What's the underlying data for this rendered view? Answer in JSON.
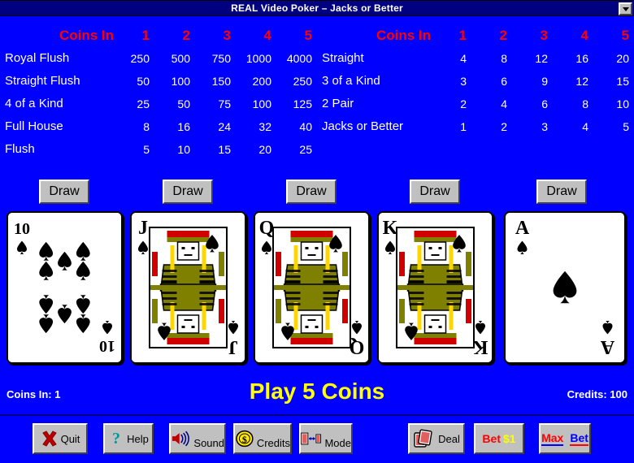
{
  "window": {
    "title": "REAL Video Poker – Jacks or Better",
    "combo_icon": "chevron-down-icon"
  },
  "colors": {
    "background": "#0000FF",
    "titlebar": "#000080",
    "paytable_header": "#FF0000",
    "paytable_value": "#FFFFFF",
    "message": "#FFFF00",
    "button_face": "#C0C0C0"
  },
  "paytable": {
    "header_label": "Coins In",
    "columns": [
      "1",
      "2",
      "3",
      "4",
      "5"
    ],
    "left_rows": [
      {
        "hand": "Royal Flush",
        "payouts": [
          "250",
          "500",
          "750",
          "1000",
          "4000"
        ]
      },
      {
        "hand": "Straight Flush",
        "payouts": [
          "50",
          "100",
          "150",
          "200",
          "250"
        ]
      },
      {
        "hand": "4 of a Kind",
        "payouts": [
          "25",
          "50",
          "75",
          "100",
          "125"
        ]
      },
      {
        "hand": "Full House",
        "payouts": [
          "8",
          "16",
          "24",
          "32",
          "40"
        ]
      },
      {
        "hand": "Flush",
        "payouts": [
          "5",
          "10",
          "15",
          "20",
          "25"
        ]
      }
    ],
    "right_rows": [
      {
        "hand": "Straight",
        "payouts": [
          "4",
          "8",
          "12",
          "16",
          "20"
        ]
      },
      {
        "hand": "3 of a Kind",
        "payouts": [
          "3",
          "6",
          "9",
          "12",
          "15"
        ]
      },
      {
        "hand": "2 Pair",
        "payouts": [
          "2",
          "4",
          "6",
          "8",
          "10"
        ]
      },
      {
        "hand": "Jacks or Better",
        "payouts": [
          "1",
          "2",
          "3",
          "4",
          "5"
        ]
      }
    ]
  },
  "draw_buttons": [
    {
      "label": "Draw"
    },
    {
      "label": "Draw"
    },
    {
      "label": "Draw"
    },
    {
      "label": "Draw"
    },
    {
      "label": "Draw"
    }
  ],
  "hand": [
    {
      "rank": "10",
      "suit": "spades",
      "suit_symbol": "♠",
      "color": "#000000",
      "type": "pip",
      "pips": 10
    },
    {
      "rank": "J",
      "suit": "spades",
      "suit_symbol": "♠",
      "color": "#000000",
      "type": "court"
    },
    {
      "rank": "Q",
      "suit": "spades",
      "suit_symbol": "♠",
      "color": "#000000",
      "type": "court"
    },
    {
      "rank": "K",
      "suit": "spades",
      "suit_symbol": "♠",
      "color": "#000000",
      "type": "court"
    },
    {
      "rank": "A",
      "suit": "spades",
      "suit_symbol": "♠",
      "color": "#000000",
      "type": "pip",
      "pips": 1
    }
  ],
  "status": {
    "coins_in": "Coins In: 1",
    "message": "Play 5 Coins",
    "credits": "Credits: 100"
  },
  "toolbar": [
    {
      "label": "Quit",
      "icon": "red-x-icon"
    },
    {
      "label": "Help",
      "icon": "question-mark-icon"
    },
    {
      "label": "Sound",
      "icon": "speaker-icon"
    },
    {
      "label": "Credits",
      "icon": "gold-coin-icon"
    },
    {
      "label": "Mode",
      "icon": "card-swap-icon"
    },
    {
      "label": "Deal",
      "icon": "card-deck-icon"
    }
  ],
  "bet_buttons": {
    "bet_word": "Bet",
    "bet_amount": "$1",
    "max_word": "Max",
    "max_bet_word": "Bet"
  }
}
